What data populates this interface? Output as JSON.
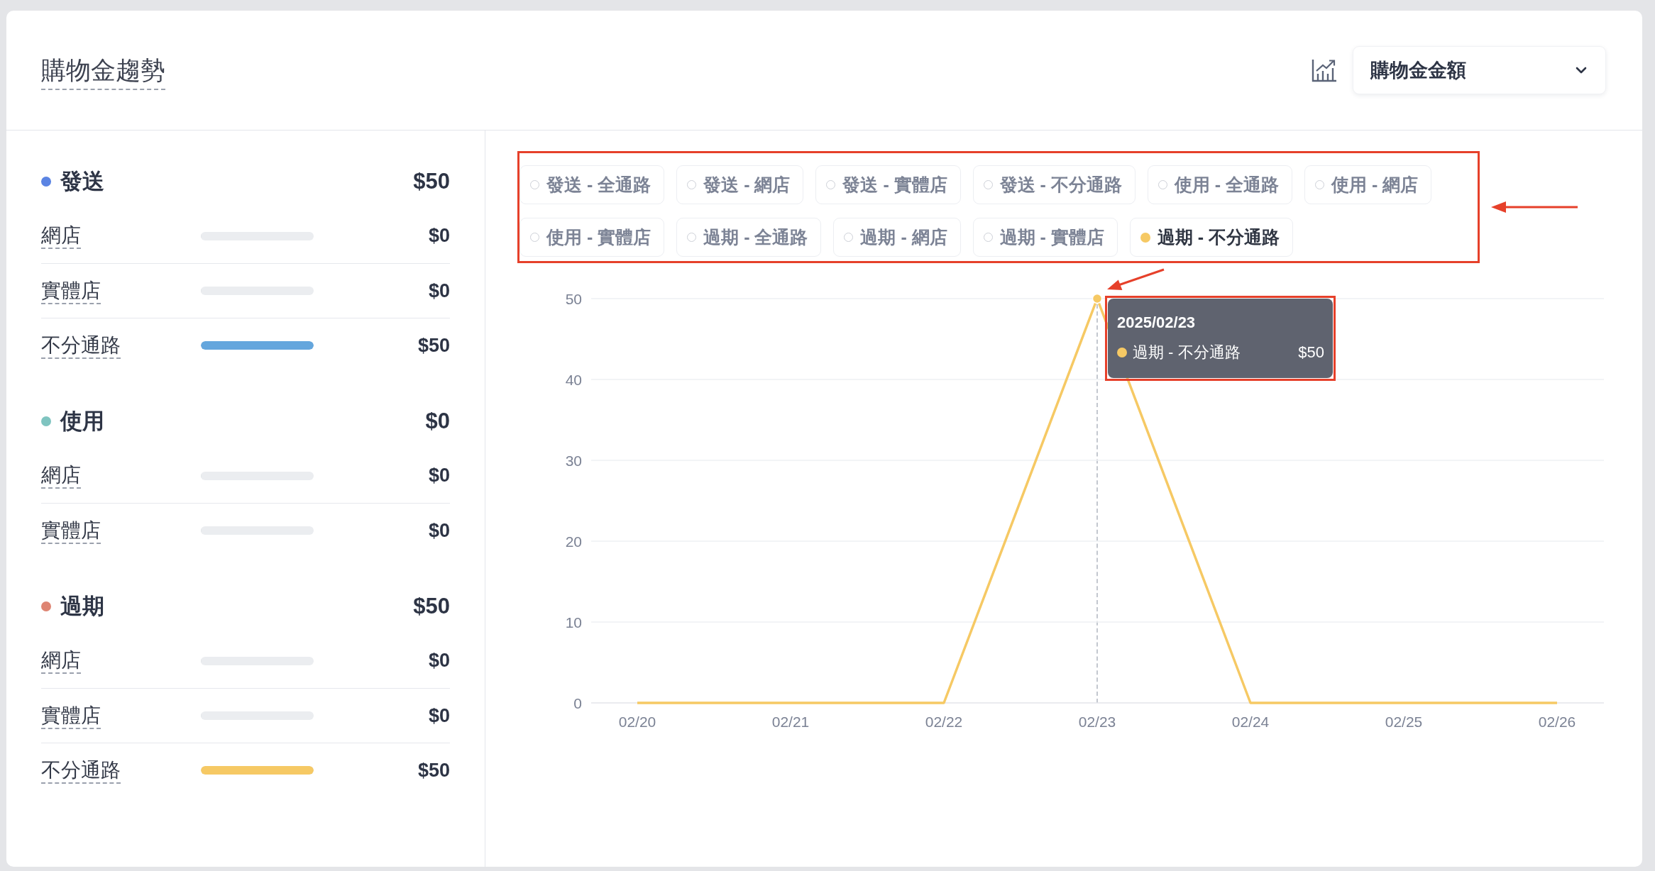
{
  "header": {
    "title": "購物金趨勢",
    "metric_select": {
      "value": "購物金金額"
    }
  },
  "summary": [
    {
      "name": "發送",
      "color": "#5b84e3",
      "total": "$50",
      "rows": [
        {
          "label": "網店",
          "level": 0,
          "value": "$0"
        },
        {
          "label": "實體店",
          "level": 0,
          "value": "$0"
        },
        {
          "label": "不分通路",
          "level": 1,
          "value": "$50",
          "color": "#64a6dd"
        }
      ]
    },
    {
      "name": "使用",
      "color": "#7fc4c0",
      "total": "$0",
      "rows": [
        {
          "label": "網店",
          "level": 0,
          "value": "$0"
        },
        {
          "label": "實體店",
          "level": 0,
          "value": "$0"
        }
      ]
    },
    {
      "name": "過期",
      "color": "#de8573",
      "total": "$50",
      "rows": [
        {
          "label": "網店",
          "level": 0,
          "value": "$0"
        },
        {
          "label": "實體店",
          "level": 0,
          "value": "$0"
        },
        {
          "label": "不分通路",
          "level": 1,
          "value": "$50",
          "color": "#f6c964"
        }
      ]
    }
  ],
  "legend": [
    {
      "label": "發送 - 全通路",
      "selected": false
    },
    {
      "label": "發送 - 網店",
      "selected": false
    },
    {
      "label": "發送 - 實體店",
      "selected": false
    },
    {
      "label": "發送 - 不分通路",
      "selected": false
    },
    {
      "label": "使用 - 全通路",
      "selected": false
    },
    {
      "label": "使用 - 網店",
      "selected": false
    },
    {
      "label": "使用 - 實體店",
      "selected": false
    },
    {
      "label": "過期 - 全通路",
      "selected": false
    },
    {
      "label": "過期 - 網店",
      "selected": false
    },
    {
      "label": "過期 - 實體店",
      "selected": false
    },
    {
      "label": "過期 - 不分通路",
      "selected": true,
      "color": "#f6c964"
    }
  ],
  "chart": {
    "chart_data": {
      "type": "line",
      "categories": [
        "02/20",
        "02/21",
        "02/22",
        "02/23",
        "02/24",
        "02/25",
        "02/26"
      ],
      "series": [
        {
          "color": "#f6c964",
          "values": [
            0,
            0,
            0,
            50,
            0,
            0,
            0
          ]
        }
      ],
      "ylim": [
        0,
        50
      ],
      "yticks": [
        0,
        10,
        20,
        30,
        40,
        50
      ],
      "grid": true
    },
    "tooltip": {
      "title": "2025/02/23",
      "items": [
        {
          "label": "過期 - 不分通路",
          "value": "$50",
          "color": "#f6c964"
        }
      ]
    }
  }
}
